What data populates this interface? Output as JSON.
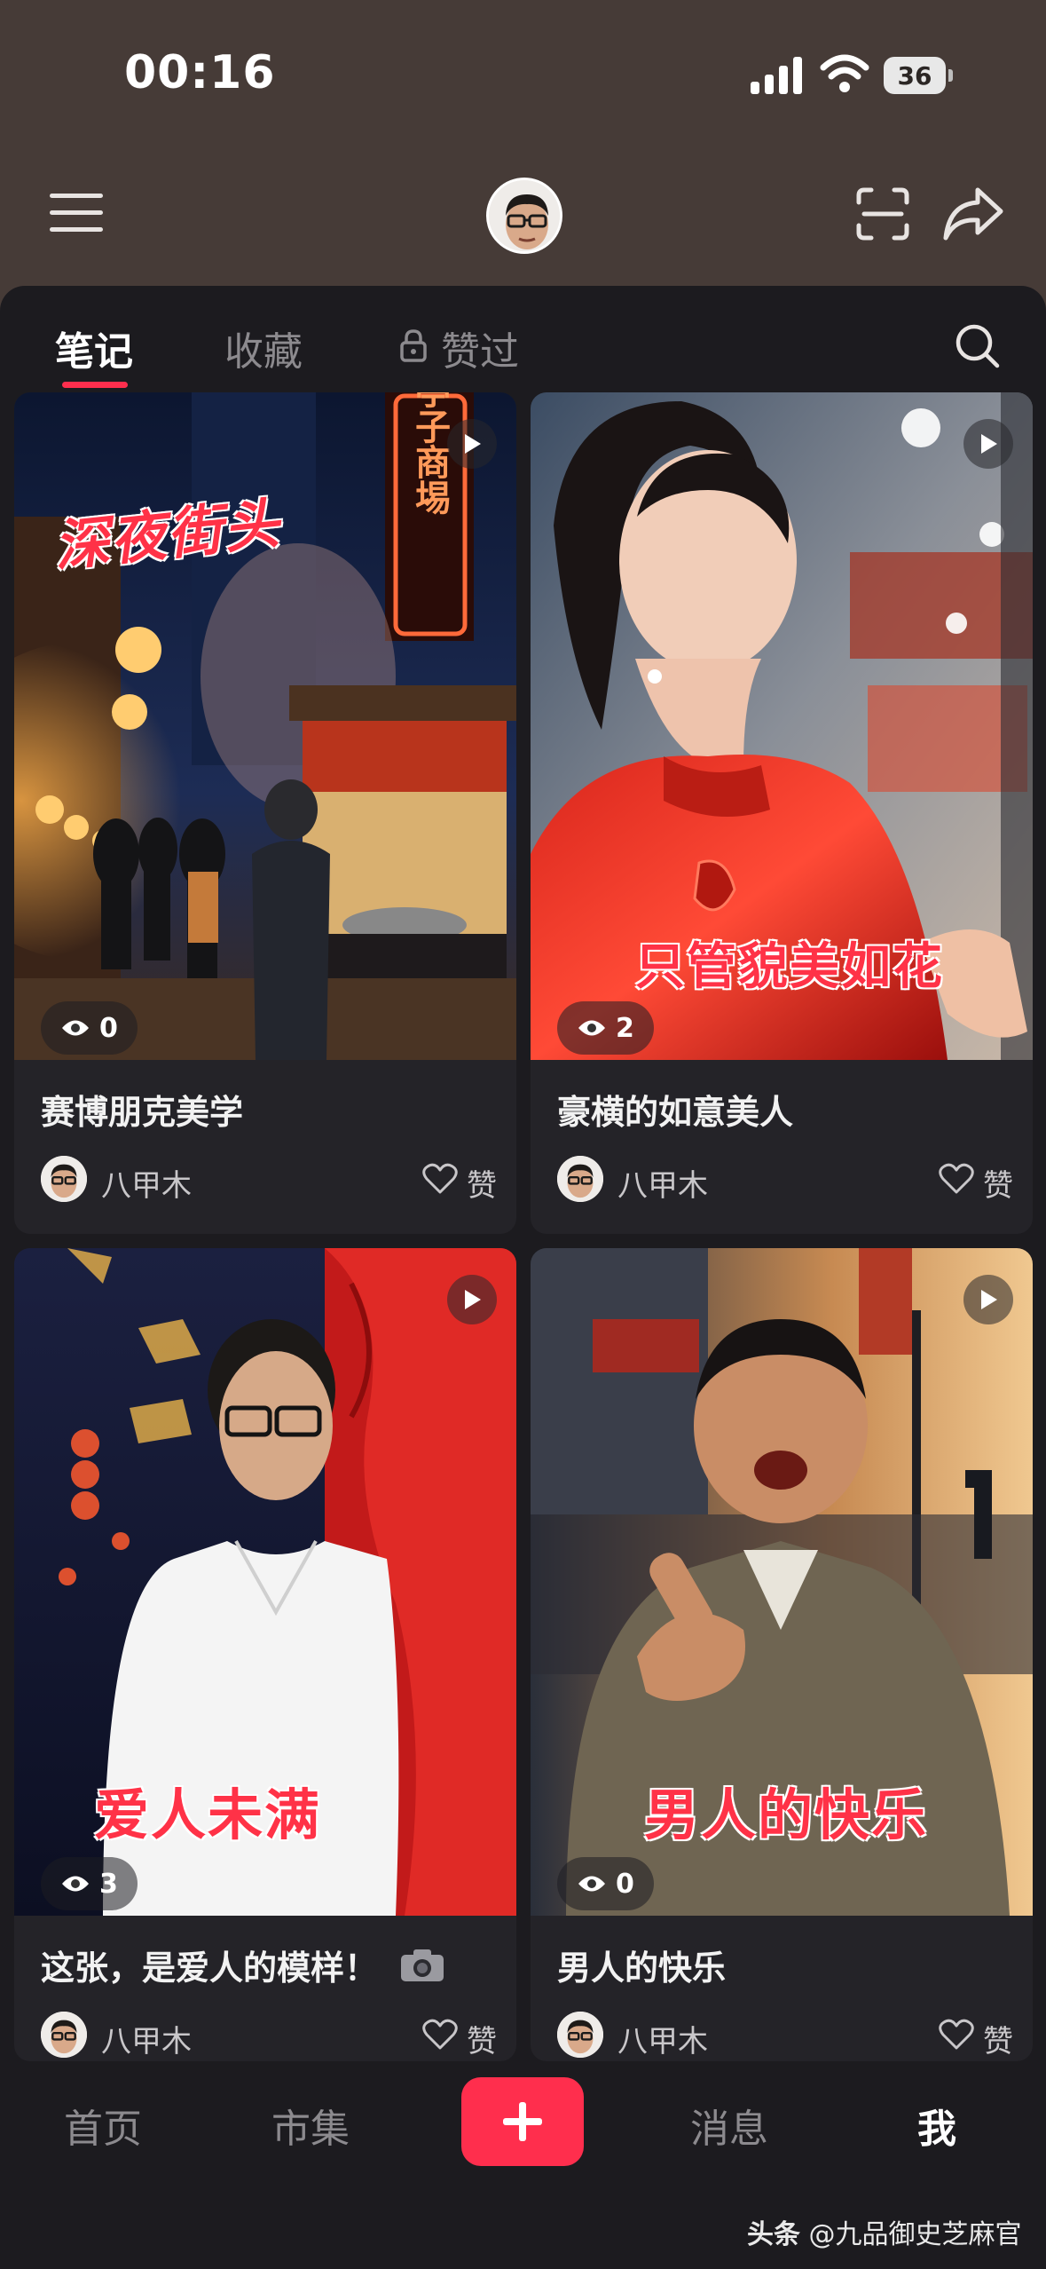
{
  "status": {
    "time": "00:16",
    "battery": "36"
  },
  "tabs": [
    {
      "label": "笔记",
      "active": true
    },
    {
      "label": "收藏",
      "active": false
    },
    {
      "label": "赞过",
      "active": false,
      "locked": true
    }
  ],
  "cards": [
    {
      "title": "赛博朋克美学",
      "views": "0",
      "author": "八甲木",
      "like_label": "赞",
      "overlay": "深夜街头",
      "sign": "亭子商埸"
    },
    {
      "title": "豪横的如意美人",
      "views": "2",
      "author": "八甲木",
      "like_label": "赞",
      "overlay": "只管貌美如花"
    },
    {
      "title": "这张，是爱人的模样！",
      "views": "3",
      "author": "八甲木",
      "like_label": "赞",
      "overlay": "爱人未满"
    },
    {
      "title": "男人的快乐",
      "views": "0",
      "author": "八甲木",
      "like_label": "赞",
      "overlay": "男人的快乐"
    }
  ],
  "nav": {
    "home": "首页",
    "market": "市集",
    "messages": "消息",
    "me": "我"
  },
  "watermark": {
    "brand": "头条",
    "handle": "@九品御史芝麻官"
  },
  "colors": {
    "accent": "#ff2e4d",
    "header": "#463b37",
    "background": "#1c1b1f"
  },
  "icons": [
    "menu-icon",
    "scan-icon",
    "share-icon",
    "search-icon",
    "lock-icon",
    "play-icon",
    "eye-icon",
    "heart-icon",
    "plus-icon",
    "camera-icon"
  ]
}
